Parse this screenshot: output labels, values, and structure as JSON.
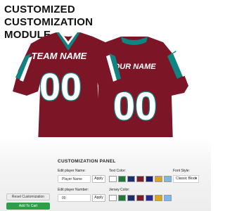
{
  "heading": {
    "line1": "CUSTOMIZED",
    "line2": "CUSTOMIZATION",
    "line3": "MODULE"
  },
  "jersey": {
    "front_name": "TEAM NAME",
    "front_number": "00",
    "back_name": "YOUR NAME",
    "back_number": "00",
    "colors": {
      "body": "#7c1627",
      "accent": "#0f8583",
      "trim": "#ffffff",
      "text": "#ffffff"
    }
  },
  "panel": {
    "title": "CUSTOMIZATION PANEL",
    "player_name_label": "Edit player Name:",
    "player_name_value": "Player Name",
    "player_number_label": "Edit player Number:",
    "player_number_value": "00",
    "apply_label": "Apply",
    "text_color_label": "Text Color:",
    "jersey_color_label": "Jersey Color:",
    "font_style_label": "Font Style:",
    "font_style_value": "Classic Block",
    "text_colors": [
      "#ffffff",
      "#1f7a3a",
      "#1b2f6e",
      "#7d1d2a",
      "#1a1a7a",
      "#d9a520",
      "#7fb8e6"
    ],
    "jersey_colors": [
      "#ffffff",
      "#1f7a3a",
      "#1b2f6e",
      "#7d1d2a",
      "#2a2a8a",
      "#d9a520",
      "#7fb8e6"
    ]
  },
  "actions": {
    "reset_label": "Reset Customization",
    "cart_label": "Add To Cart"
  }
}
